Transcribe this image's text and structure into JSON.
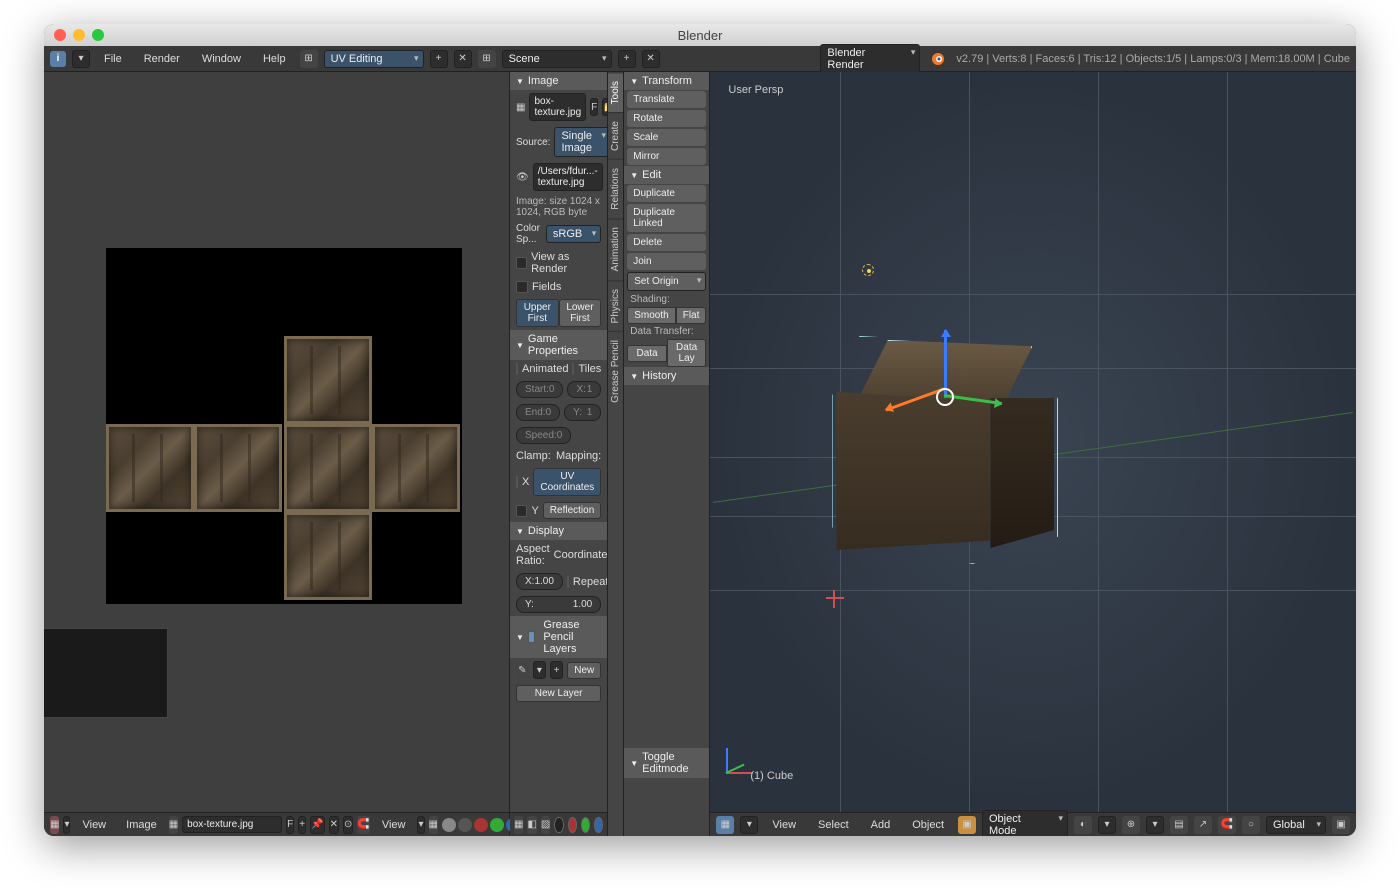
{
  "window_title": "Blender",
  "topbar": {
    "menus": [
      "File",
      "Render",
      "Window",
      "Help"
    ],
    "layout": "UV Editing",
    "scene_label": "Scene",
    "renderer": "Blender Render",
    "stats": "v2.79 | Verts:8 | Faces:6 | Tris:12 | Objects:1/5 | Lamps:0/3 | Mem:18.00M | Cube"
  },
  "uv_editor": {
    "footer": {
      "view": "View",
      "image": "Image",
      "filename": "box-texture.jpg",
      "fake_user": "F"
    },
    "viewmenu": "View"
  },
  "image_panel": {
    "header": "Image",
    "filename": "box-texture.jpg",
    "fake_user": "F",
    "source_label": "Source:",
    "source_value": "Single Image",
    "filepath": "/Users/fdur...-texture.jpg",
    "info": "Image: size 1024 x 1024, RGB byte",
    "colorspace_label": "Color Sp...",
    "colorspace_value": "sRGB",
    "view_as_render": "View as Render",
    "fields": "Fields",
    "upper_first": "Upper First",
    "lower_first": "Lower First"
  },
  "game_props": {
    "header": "Game Properties",
    "animated": "Animated",
    "tiles": "Tiles",
    "start": "Start:",
    "start_val": "0",
    "end": "End:",
    "end_val": "0",
    "speed": "Speed:",
    "speed_val": "0",
    "x": "X:",
    "x_val": "1",
    "y": "Y:",
    "y_val": "1",
    "clamp": "Clamp:",
    "clamp_x": "X",
    "clamp_y": "Y",
    "mapping": "Mapping:",
    "uv_coords": "UV Coordinates",
    "reflection": "Reflection"
  },
  "display_panel": {
    "header": "Display",
    "aspect": "Aspect Ratio:",
    "x": "X:",
    "x_val": "1.00",
    "y": "Y:",
    "y_val": "1.00",
    "coords": "Coordinates:",
    "repeat": "Repeat"
  },
  "grease": {
    "header": "Grease Pencil Layers",
    "new": "New",
    "new_layer": "New Layer"
  },
  "vtabs": [
    "Tools",
    "Create",
    "Relations",
    "Animation",
    "Physics",
    "Grease Pencil"
  ],
  "tools": {
    "transform_hdr": "Transform",
    "translate": "Translate",
    "rotate": "Rotate",
    "scale": "Scale",
    "mirror": "Mirror",
    "edit_hdr": "Edit",
    "duplicate": "Duplicate",
    "dup_linked": "Duplicate Linked",
    "delete": "Delete",
    "join": "Join",
    "set_origin": "Set Origin",
    "shading": "Shading:",
    "smooth": "Smooth",
    "flat": "Flat",
    "data_transfer": "Data Transfer:",
    "data": "Data",
    "data_lay": "Data Lay",
    "history_hdr": "History",
    "toggle_edit": "Toggle Editmode"
  },
  "view3d": {
    "persp": "User Persp",
    "obj_label": "(1) Cube",
    "footer": {
      "view": "View",
      "select": "Select",
      "add": "Add",
      "object": "Object",
      "mode": "Object Mode",
      "orientation": "Global"
    }
  }
}
